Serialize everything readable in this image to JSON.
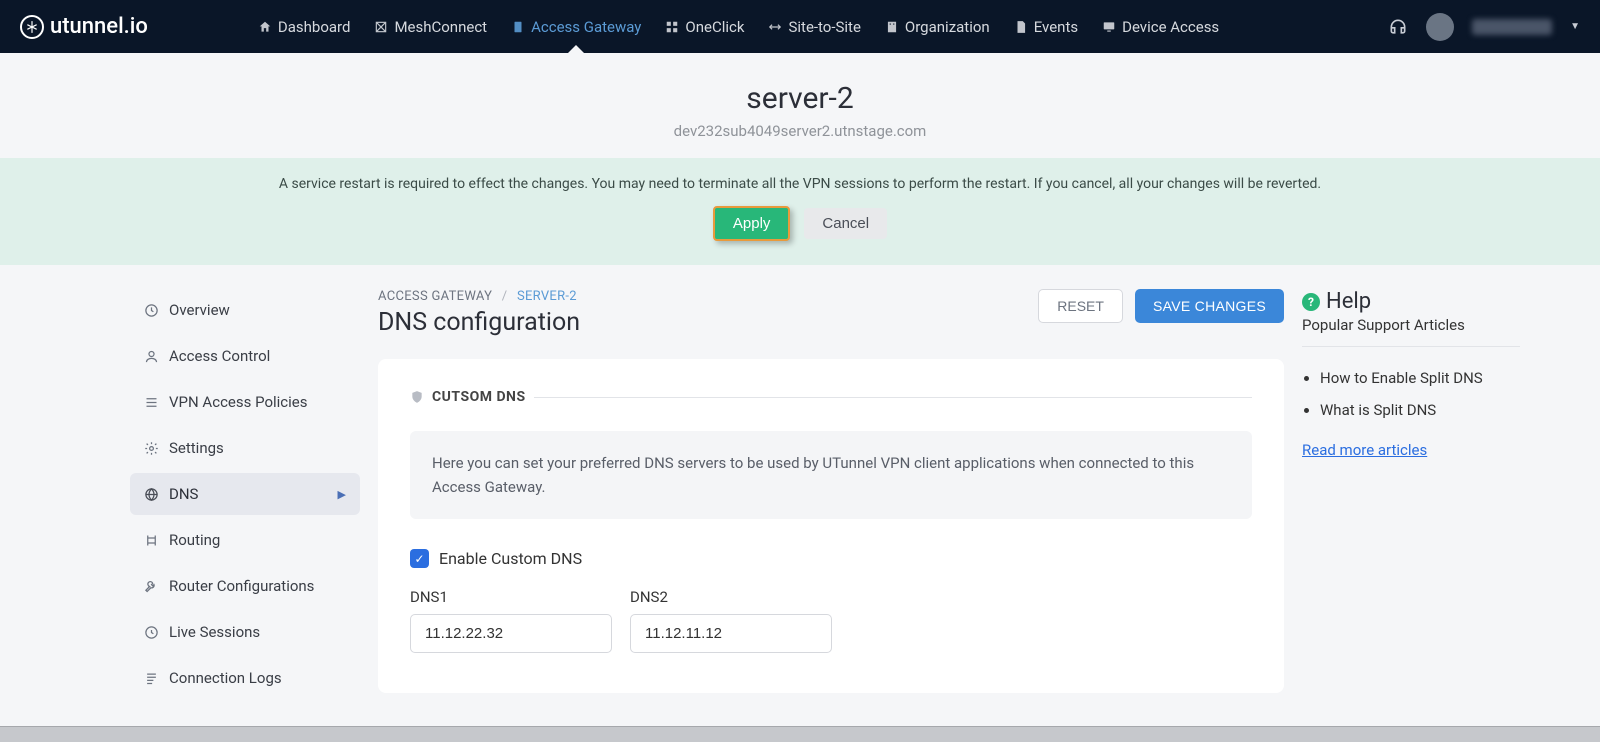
{
  "logo": "utunnel.io",
  "nav": [
    {
      "label": "Dashboard",
      "icon": "home"
    },
    {
      "label": "MeshConnect",
      "icon": "mesh"
    },
    {
      "label": "Access Gateway",
      "icon": "gateway",
      "active": true
    },
    {
      "label": "OneClick",
      "icon": "grid"
    },
    {
      "label": "Site-to-Site",
      "icon": "swap"
    },
    {
      "label": "Organization",
      "icon": "building"
    },
    {
      "label": "Events",
      "icon": "doc"
    },
    {
      "label": "Device Access",
      "icon": "monitor"
    }
  ],
  "header": {
    "title": "server-2",
    "subtitle": "dev232sub4049server2.utnstage.com"
  },
  "banner": {
    "text": "A service restart is required to effect the changes. You may need to terminate all the VPN sessions to perform the restart. If you cancel, all your changes will be reverted.",
    "apply": "Apply",
    "cancel": "Cancel"
  },
  "sidebar": [
    {
      "label": "Overview",
      "icon": "clock"
    },
    {
      "label": "Access Control",
      "icon": "user"
    },
    {
      "label": "VPN Access Policies",
      "icon": "list"
    },
    {
      "label": "Settings",
      "icon": "gear"
    },
    {
      "label": "DNS",
      "icon": "globe",
      "active": true
    },
    {
      "label": "Routing",
      "icon": "route"
    },
    {
      "label": "Router Configurations",
      "icon": "wrench"
    },
    {
      "label": "Live Sessions",
      "icon": "clock2"
    },
    {
      "label": "Connection Logs",
      "icon": "logs"
    }
  ],
  "crumbs": {
    "root": "ACCESS GATEWAY",
    "current": "SERVER-2"
  },
  "main": {
    "title": "DNS configuration",
    "reset": "RESET",
    "save": "SAVE CHANGES",
    "section_title": "CUTSOM DNS",
    "infobox": "Here you can set your preferred DNS servers to be used by UTunnel VPN client applications when connected to this Access Gateway.",
    "enable_label": "Enable Custom DNS",
    "dns1_label": "DNS1",
    "dns1_value": "11.12.22.32",
    "dns2_label": "DNS2",
    "dns2_value": "11.12.11.12"
  },
  "help": {
    "title": "Help",
    "subtitle": "Popular Support Articles",
    "items": [
      "How to Enable Split DNS",
      "What is Split DNS"
    ],
    "more": "Read more articles"
  }
}
